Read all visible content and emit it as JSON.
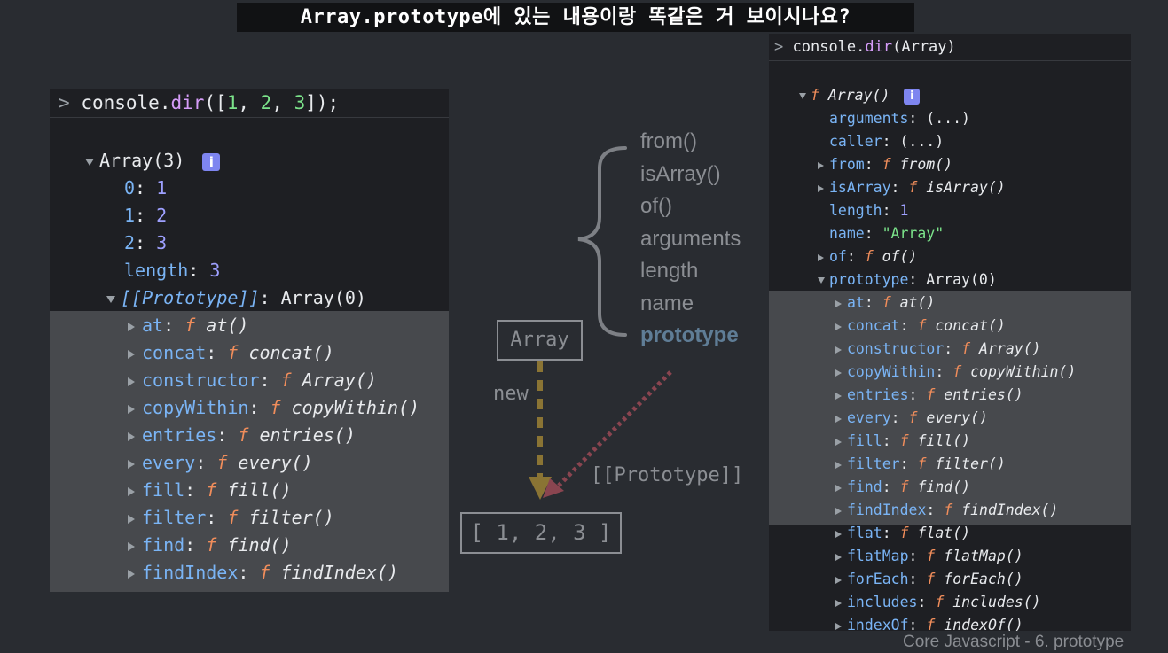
{
  "caption": "Array.prototype에 있는 내용이랑 똑같은 거 보이시나요?",
  "left_console": {
    "command_prefix": "console.",
    "command_fn": "dir",
    "command_open": "([",
    "command_args": [
      "1",
      "2",
      "3"
    ],
    "command_close": "]);",
    "array_label": "Array(3)",
    "info_badge": "i",
    "items": [
      {
        "key": "0",
        "value": "1"
      },
      {
        "key": "1",
        "value": "2"
      },
      {
        "key": "2",
        "value": "3"
      }
    ],
    "length_key": "length",
    "length_value": "3",
    "proto_key": "[[Prototype]]",
    "proto_value": "Array(0)",
    "methods": [
      "at",
      "concat",
      "constructor",
      "copyWithin",
      "entries",
      "every",
      "fill",
      "filter",
      "find",
      "findIndex"
    ],
    "method_values": [
      "at()",
      "concat()",
      "Array()",
      "copyWithin()",
      "entries()",
      "every()",
      "fill()",
      "filter()",
      "find()",
      "findIndex()"
    ]
  },
  "right_console": {
    "command_prefix": "console.",
    "command_fn": "dir",
    "command_args": "(Array)",
    "root_label": "Array()",
    "f_symbol": "f",
    "info_badge": "i",
    "arguments_key": "arguments",
    "arguments_value": "(...)",
    "caller_key": "caller",
    "caller_value": "(...)",
    "from_key": "from",
    "from_value": "from()",
    "isArray_key": "isArray",
    "isArray_value": "isArray()",
    "length_key": "length",
    "length_value": "1",
    "name_key": "name",
    "name_value": "\"Array\"",
    "of_key": "of",
    "of_value": "of()",
    "prototype_key": "prototype",
    "prototype_value": "Array(0)",
    "methods": [
      "at",
      "concat",
      "constructor",
      "copyWithin",
      "entries",
      "every",
      "fill",
      "filter",
      "find",
      "findIndex",
      "flat",
      "flatMap",
      "forEach",
      "includes",
      "indexOf"
    ],
    "method_values": [
      "at()",
      "concat()",
      "Array()",
      "copyWithin()",
      "entries()",
      "every()",
      "fill()",
      "filter()",
      "find()",
      "findIndex()",
      "flat()",
      "flatMap()",
      "forEach()",
      "includes()",
      "indexOf()"
    ]
  },
  "diagram": {
    "static_members": [
      "from()",
      "isArray()",
      "of()",
      "arguments",
      "length",
      "name",
      "prototype"
    ],
    "constructor_box": "Array",
    "new_label": "new",
    "proto_label": "[[Prototype]]",
    "instance_box": "[ 1, 2, 3 ]",
    "colors": {
      "arrow_new": "#8a7434",
      "arrow_proto": "#8a4550",
      "prototype_text": "#5f7d96"
    }
  },
  "footer": "Core Javascript - 6. prototype"
}
